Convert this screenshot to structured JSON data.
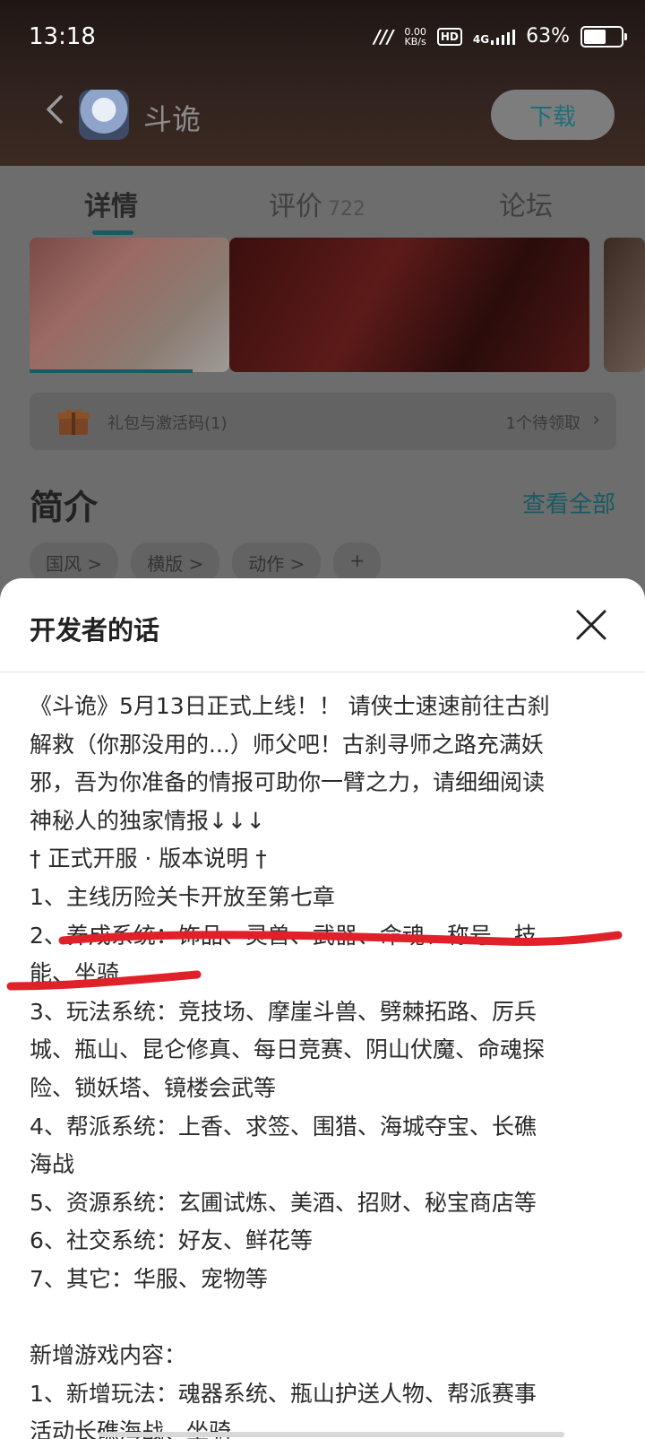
{
  "status_bar": {
    "time": "13:18",
    "net_speed_value": "0.00",
    "net_speed_unit": "KB/s",
    "hd": "HD",
    "network": "4G",
    "battery": "63%",
    "battery_level": 0.63
  },
  "app_bar": {
    "title": "斗诡",
    "download_label": "下载"
  },
  "tabs": [
    {
      "label": "详情"
    },
    {
      "label": "评价",
      "count": "722"
    },
    {
      "label": "论坛"
    }
  ],
  "gift": {
    "label": "礼包与激活码(1)",
    "status": "1个待领取"
  },
  "intro": {
    "title": "简介",
    "see_all": "查看全部",
    "tags": [
      "国风 >",
      "横版 >",
      "动作 >",
      "+"
    ]
  },
  "sheet": {
    "title": "开发者的话",
    "lines": [
      "《斗诡》5月13日正式上线！！ 请侠士速速前往古刹",
      "解救（你那没用的...）师父吧！古刹寻师之路充满妖",
      "邪，吾为你准备的情报可助你一臂之力，请细细阅读",
      "神秘人的独家情报↓↓↓",
      "† 正式开服 · 版本说明 †",
      "1、主线历险关卡开放至第七章",
      "2、养成系统：饰品、灵兽、武器、命魂、称号、技",
      "能、坐骑",
      "3、玩法系统：竞技场、摩崖斗兽、劈棘拓路、厉兵",
      "城、瓶山、昆仑修真、每日竞赛、阴山伏魔、命魂探",
      "险、锁妖塔、镜楼会武等",
      "4、帮派系统：上香、求签、围猎、海城夺宝、长礁",
      "海战",
      "5、资源系统：玄圃试炼、美酒、招财、秘宝商店等",
      "6、社交系统：好友、鲜花等",
      "7、其它：华服、宠物等",
      "",
      "新增游戏内容：",
      "1、新增玩法：魂器系统、瓶山护送人物、帮派赛事",
      "活动长礁海战、坐骑"
    ]
  },
  "colors": {
    "accent": "#1b5a63",
    "underline": "#e0212a"
  }
}
